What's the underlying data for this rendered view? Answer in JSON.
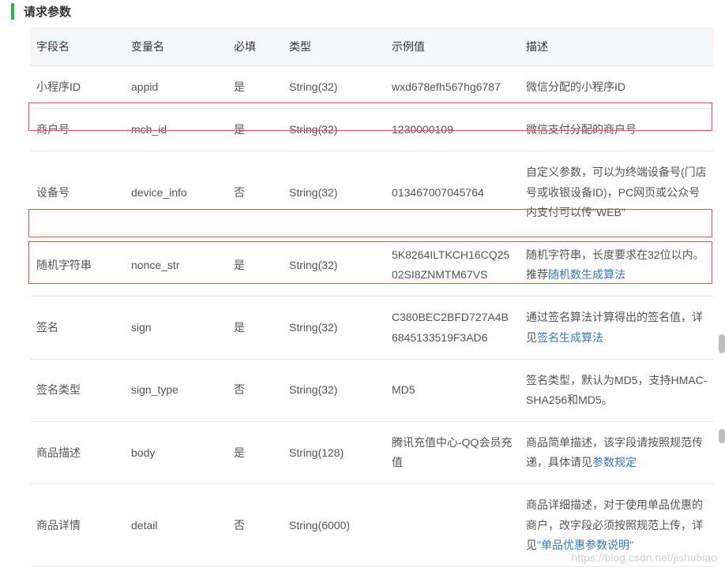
{
  "section_title": "请求参数",
  "headers": {
    "field": "字段名",
    "var": "变量名",
    "req": "必填",
    "type": "类型",
    "example": "示例值",
    "desc": "描述"
  },
  "rows": {
    "appid": {
      "field": "小程序ID",
      "var": "appid",
      "req": "是",
      "type": "String(32)",
      "example": "wxd678efh567hg6787",
      "desc": "微信分配的小程序ID"
    },
    "mch_id": {
      "field": "商户号",
      "var": "mch_id",
      "req": "是",
      "type": "String(32)",
      "example": "1230000109",
      "desc": "微信支付分配的商户号"
    },
    "device_info": {
      "field": "设备号",
      "var": "device_info",
      "req": "否",
      "type": "String(32)",
      "example": "013467007045764",
      "desc": "自定义参数，可以为终端设备号(门店号或收银设备ID)，PC网页或公众号内支付可以传\"WEB\""
    },
    "nonce_str": {
      "field": "随机字符串",
      "var": "nonce_str",
      "req": "是",
      "type": "String(32)",
      "example": "5K8264ILTKCH16CQ2502SI8ZNMTM67VS",
      "desc_prefix": "随机字符串，长度要求在32位以内。推荐",
      "desc_link": "随机数生成算法"
    },
    "sign": {
      "field": "签名",
      "var": "sign",
      "req": "是",
      "type": "String(32)",
      "example": "C380BEC2BFD727A4B6845133519F3AD6",
      "desc_prefix": "通过签名算法计算得出的签名值，详见",
      "desc_link": "签名生成算法"
    },
    "sign_type": {
      "field": "签名类型",
      "var": "sign_type",
      "req": "否",
      "type": "String(32)",
      "example": "MD5",
      "desc": "签名类型，默认为MD5，支持HMAC-SHA256和MD5。"
    },
    "body": {
      "field": "商品描述",
      "var": "body",
      "req": "是",
      "type": "String(128)",
      "example": "腾讯充值中心-QQ会员充值",
      "desc_prefix": "商品简单描述，该字段请按照规范传递，具体请见",
      "desc_link": "参数规定"
    },
    "detail": {
      "field": "商品详情",
      "var": "detail",
      "req": "否",
      "type": "String(6000)",
      "example": "",
      "desc_prefix": "商品详细描述，对于使用单品优惠的商户，改字段必须按照规范上传，详见",
      "desc_link": "\"单品优惠参数说明\""
    }
  },
  "watermark": "https://blog.csdn.net/jishubiao"
}
